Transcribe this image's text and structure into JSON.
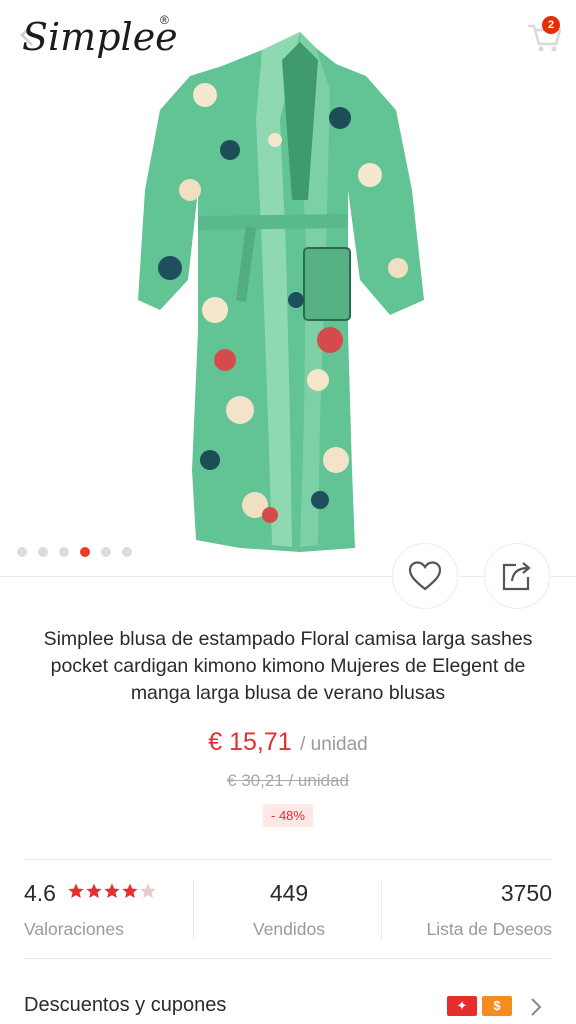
{
  "header": {
    "brand": "Simplee",
    "brand_mark": "®",
    "cart_count": "2"
  },
  "gallery": {
    "total_images": 6,
    "active_index": 3
  },
  "product": {
    "title": "Simplee blusa de estampado Floral camisa larga sashes pocket cardigan kimono kimono Mujeres de Elegent de manga larga blusa de verano blusas",
    "price": "€ 15,71",
    "unit": "/ unidad",
    "original_price": "€ 30,21  / unidad",
    "discount": "- 48%"
  },
  "stats": {
    "rating": "4.6",
    "rating_stars": 4.6,
    "rating_label": "Valoraciones",
    "sold": "449",
    "sold_label": "Vendidos",
    "wishlist": "3750",
    "wishlist_label": "Lista de Deseos"
  },
  "coupons": {
    "label": "Descuentos y cupones",
    "icon_1": "✦",
    "icon_2": "$"
  },
  "icons": {
    "back": "chevron-left-icon",
    "cart": "cart-icon",
    "wishlist": "heart-icon",
    "share": "share-icon",
    "more": "chevron-right-icon"
  },
  "colors": {
    "accent_red": "#e62e2e",
    "discount_bg": "#fde8e7",
    "kimono_green": "#5fbf8f",
    "coupon_orange": "#f68b1e"
  }
}
